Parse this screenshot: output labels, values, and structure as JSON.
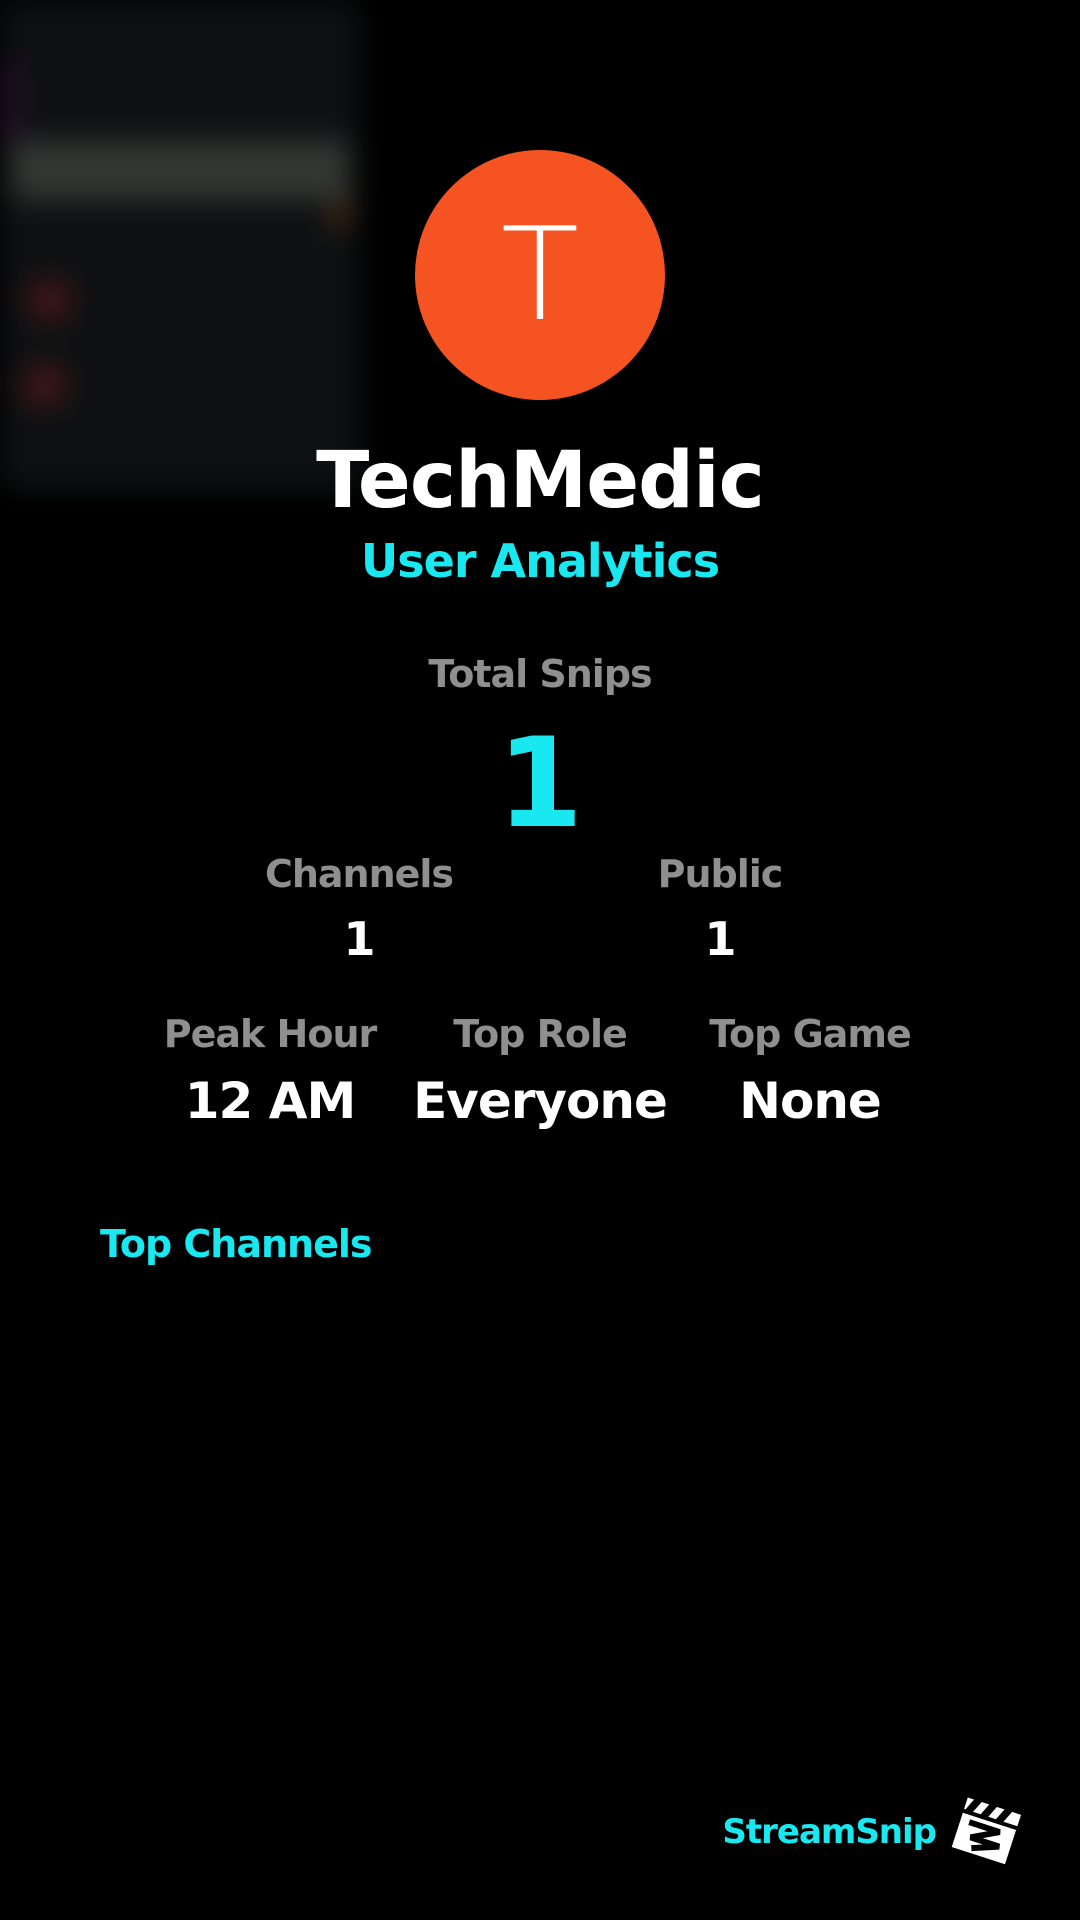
{
  "colors": {
    "background": "#000000",
    "accent": "#19E8F0",
    "avatar_bg": "#F55322",
    "label_gray": "#8F8F8F",
    "value_white": "#FFFFFF"
  },
  "profile": {
    "avatar_letter": "T",
    "username": "TechMedic",
    "subtitle": "User Analytics"
  },
  "total_snips": {
    "label": "Total Snips",
    "value": "1"
  },
  "stats_row1": [
    {
      "label": "Channels",
      "value": "1"
    },
    {
      "label": "Public",
      "value": "1"
    }
  ],
  "stats_row2": [
    {
      "label": "Peak Hour",
      "value": "12 AM"
    },
    {
      "label": "Top Role",
      "value": "Everyone"
    },
    {
      "label": "Top Game",
      "value": "None"
    }
  ],
  "top_channels": {
    "title": "Top Channels",
    "items": []
  },
  "footer": {
    "brand": "StreamSnip",
    "logo_icon": "clapperboard-icon"
  }
}
